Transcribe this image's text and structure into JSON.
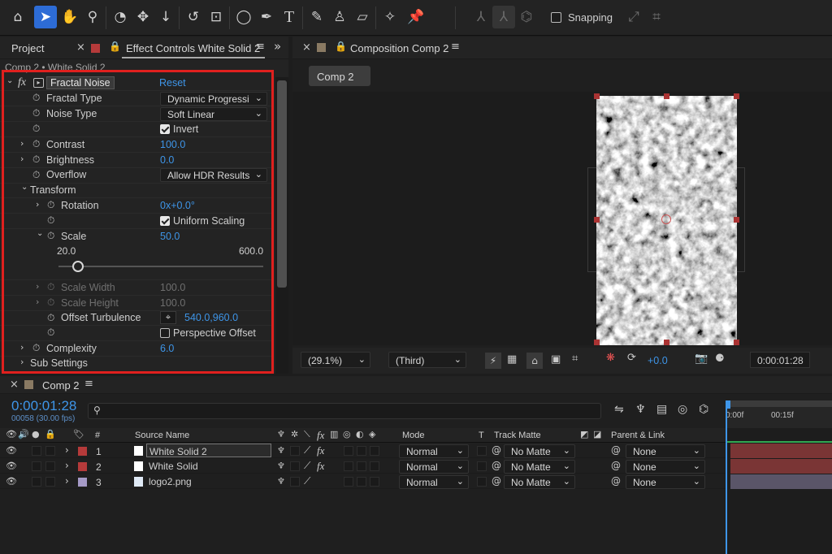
{
  "toolbar": {
    "snapping_label": "Snapping"
  },
  "left_panel": {
    "tab_project": "Project",
    "tab_effect_controls": "Effect Controls White Solid 2",
    "breadcrumb": "Comp 2 • White Solid 2",
    "effect_name": "Fractal Noise",
    "reset_label": "Reset",
    "params": {
      "fractal_type_label": "Fractal Type",
      "fractal_type_value": "Dynamic Progressi",
      "noise_type_label": "Noise Type",
      "noise_type_value": "Soft Linear",
      "invert_label": "Invert",
      "contrast_label": "Contrast",
      "contrast_value": "100.0",
      "brightness_label": "Brightness",
      "brightness_value": "0.0",
      "overflow_label": "Overflow",
      "overflow_value": "Allow HDR Results",
      "transform_label": "Transform",
      "rotation_label": "Rotation",
      "rotation_value": "0x+0.0°",
      "uniform_scaling_label": "Uniform Scaling",
      "scale_label": "Scale",
      "scale_value": "50.0",
      "scale_min": "20.0",
      "scale_max": "600.0",
      "scale_fraction": 0.052,
      "scale_width_label": "Scale Width",
      "scale_width_value": "100.0",
      "scale_height_label": "Scale Height",
      "scale_height_value": "100.0",
      "offset_turbulence_label": "Offset Turbulence",
      "offset_turbulence_value": "540.0,960.0",
      "perspective_offset_label": "Perspective Offset",
      "complexity_label": "Complexity",
      "complexity_value": "6.0",
      "sub_settings_label": "Sub Settings"
    }
  },
  "composition": {
    "tab_title": "Composition Comp 2",
    "sub_tab": "Comp 2",
    "zoom": "(29.1%)",
    "resolution": "(Third)",
    "exposure": "+0.0",
    "timecode": "0:00:01:28"
  },
  "timeline": {
    "tab_title": "Comp 2",
    "timecode": "0:00:01:28",
    "frame_info": "00058 (30.00 fps)",
    "search_placeholder": "",
    "ruler_ticks": [
      "0:00f",
      "00:15f"
    ],
    "headers": {
      "hash": "#",
      "source_name": "Source Name",
      "mode": "Mode",
      "t": "T",
      "track_matte": "Track Matte",
      "parent_link": "Parent & Link"
    },
    "layers": [
      {
        "num": "1",
        "name": "White Solid 2",
        "mode": "Normal",
        "matte": "No Matte",
        "parent": "None",
        "color": "#b53a3a"
      },
      {
        "num": "2",
        "name": "White Solid",
        "mode": "Normal",
        "matte": "No Matte",
        "parent": "None",
        "color": "#b53a3a"
      },
      {
        "num": "3",
        "name": "logo2.png",
        "mode": "Normal",
        "matte": "No Matte",
        "parent": "None",
        "color": "#a59ac6"
      }
    ]
  },
  "colors": {
    "accent_blue": "#3e95e8",
    "highlight_red": "#e0201e",
    "layer_bar_red": "#7a3535",
    "layer_bar_purple": "#5a5568"
  }
}
